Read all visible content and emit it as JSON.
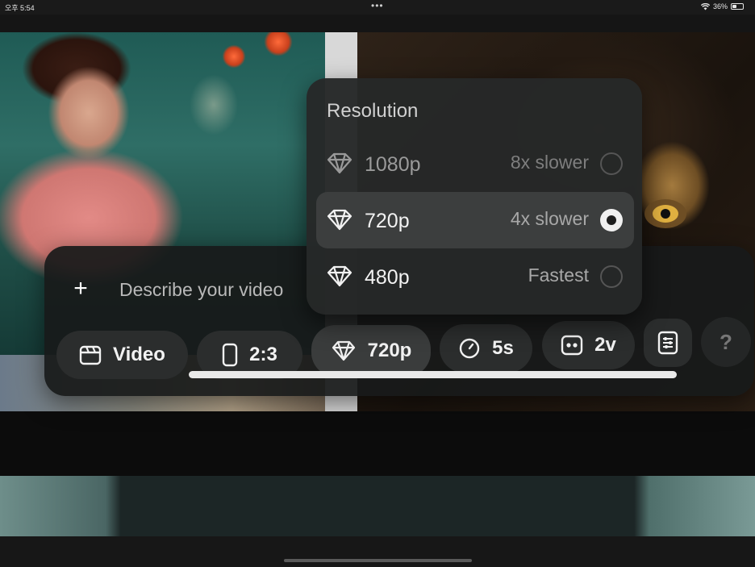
{
  "status_bar": {
    "time": "오후 5:54",
    "dots": "•••",
    "battery": "36%"
  },
  "prompt": {
    "add_label": "+",
    "placeholder": "Describe your video"
  },
  "toolbar": {
    "mode": {
      "label": "Video",
      "icon": "clapperboard-icon"
    },
    "aspect": {
      "label": "2:3",
      "icon": "phone-frame-icon"
    },
    "resolution": {
      "label": "720p",
      "icon": "diamond-icon"
    },
    "duration": {
      "label": "5s",
      "icon": "clock-icon"
    },
    "variations": {
      "label": "2v",
      "icon": "two-dots-icon"
    },
    "settings_icon": "sliders-icon",
    "help_label": "?"
  },
  "resolution_menu": {
    "title": "Resolution",
    "options": [
      {
        "label": "1080p",
        "sub": "8x slower",
        "selected": false,
        "icon": "diamond-icon"
      },
      {
        "label": "720p",
        "sub": "4x slower",
        "selected": true,
        "icon": "diamond-icon"
      },
      {
        "label": "480p",
        "sub": "Fastest",
        "selected": false,
        "icon": "diamond-icon"
      }
    ]
  },
  "colors": {
    "panel": "#181a1a",
    "chip": "#2b2d2d",
    "menu": "#262828",
    "selected_row": "#3c3e3e",
    "muted_text": "#9a9a9a"
  }
}
